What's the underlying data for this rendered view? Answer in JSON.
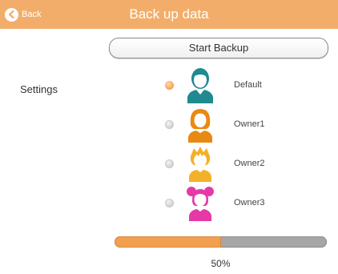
{
  "header": {
    "back_label": "Back",
    "title": "Back up data"
  },
  "start_button": {
    "label": "Start Backup"
  },
  "settings_label": "Settings",
  "options": [
    {
      "label": "Default",
      "selected": true,
      "icon": "male-avatar-icon",
      "color": "#1f8a8f"
    },
    {
      "label": "Owner1",
      "selected": false,
      "icon": "female-avatar-icon",
      "color": "#e88a12"
    },
    {
      "label": "Owner2",
      "selected": false,
      "icon": "boy-avatar-icon",
      "color": "#f3b12a"
    },
    {
      "label": "Owner3",
      "selected": false,
      "icon": "girl-avatar-icon",
      "color": "#e53aa6"
    }
  ],
  "progress": {
    "fraction": 0.5,
    "label": "50%"
  },
  "colors": {
    "header": "#f3ad6a",
    "accent": "#f2a050"
  }
}
